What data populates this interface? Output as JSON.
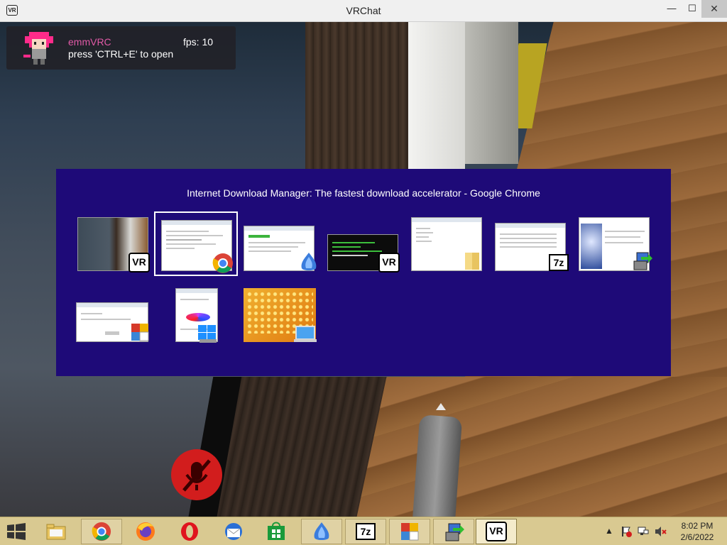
{
  "window": {
    "title": "VRChat",
    "app_icon_text": "VR",
    "minimize_glyph": "—",
    "maximize_glyph": "☐",
    "close_glyph": "✕"
  },
  "overlay": {
    "name": "emmVRC",
    "fps": "fps: 10",
    "hint": "press 'CTRL+E' to open",
    "name_color": "#e05aa6"
  },
  "switcher": {
    "title": "Internet Download Manager: The fastest download accelerator - Google Chrome",
    "background": "#1e0a78",
    "windows": [
      {
        "name": "VRChat",
        "icon": "vrchat-icon",
        "badge_text": "VR",
        "selected": false
      },
      {
        "name": "Google Chrome",
        "icon": "chrome-icon",
        "selected": true
      },
      {
        "name": "Internet Download Manager",
        "icon": "idm-icon",
        "selected": false
      },
      {
        "name": "VRChat console",
        "icon": "vrchat-icon",
        "badge_text": "VR",
        "selected": false
      },
      {
        "name": "File Explorer",
        "icon": "folder-icon",
        "selected": false
      },
      {
        "name": "7-Zip",
        "icon": "7zip-icon",
        "badge_text": "7z",
        "selected": false
      },
      {
        "name": "Installer",
        "icon": "installer-icon",
        "selected": false
      },
      {
        "name": "Installation Helper",
        "icon": "control-panel-icon",
        "selected": false
      },
      {
        "name": "Windows setup",
        "icon": "windows-setup-icon",
        "selected": false
      },
      {
        "name": "Desktop",
        "icon": "desktop-icon",
        "selected": false
      }
    ]
  },
  "taskbar": {
    "background": "#d9c991",
    "items": [
      {
        "name": "file-explorer",
        "icon": "folder-icon"
      },
      {
        "name": "chrome",
        "icon": "chrome-icon",
        "running": true
      },
      {
        "name": "firefox",
        "icon": "firefox-icon"
      },
      {
        "name": "opera",
        "icon": "opera-icon"
      },
      {
        "name": "thunderbird",
        "icon": "mail-icon"
      },
      {
        "name": "store",
        "icon": "store-icon"
      },
      {
        "name": "idm",
        "icon": "idm-icon",
        "running": true
      },
      {
        "name": "7zip",
        "icon": "7zip-icon",
        "badge_text": "7z",
        "running": true
      },
      {
        "name": "control-panel",
        "icon": "control-panel-icon",
        "running": true
      },
      {
        "name": "installer",
        "icon": "installer-icon",
        "running": true
      },
      {
        "name": "vrchat",
        "icon": "vrchat-icon",
        "badge_text": "VR",
        "active": true
      }
    ],
    "tray_icons": [
      "show-hidden-icons-icon",
      "action-center-flag-icon",
      "network-icon",
      "volume-muted-icon"
    ],
    "clock": {
      "time": "8:02 PM",
      "date": "2/6/2022"
    }
  }
}
